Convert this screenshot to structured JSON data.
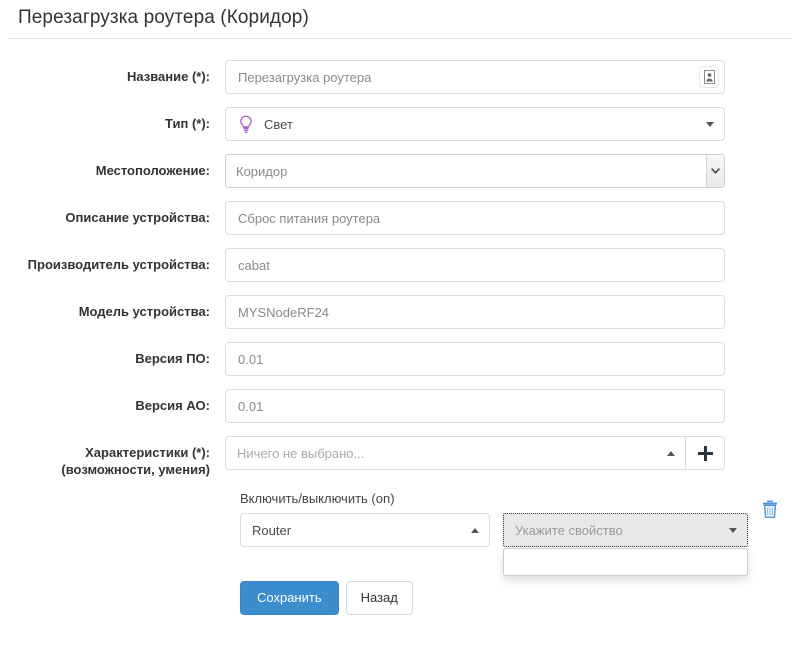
{
  "header": {
    "title": "Перезагрузка роутера (Коридор)"
  },
  "form": {
    "rows": [
      {
        "label": "Название (*):",
        "value": "Перезагрузка роутера",
        "icon": "credential-card-icon"
      },
      {
        "label": "Тип (*):",
        "value": "Свет",
        "icon": "lightbulb-icon"
      },
      {
        "label": "Местоположение:",
        "value": "Коридор",
        "icon": "chevron-down-icon"
      },
      {
        "label": "Описание устройства:",
        "value": "Сброс питания роутера",
        "icon": ""
      },
      {
        "label": "Производитель устройства:",
        "value": "cabat",
        "icon": ""
      },
      {
        "label": "Модель устройства:",
        "value": "MYSNodeRF24",
        "icon": ""
      },
      {
        "label": "Версия ПО:",
        "value": "0.01",
        "icon": ""
      },
      {
        "label": "Версия АО:",
        "value": "0.01",
        "icon": ""
      }
    ],
    "capabilities": {
      "label_main": "Характеристики (*):",
      "label_sub": "(возможности, умения)",
      "placeholder": "Ничего не выбрано...",
      "add_button": "+",
      "add_button_name": "plus-icon"
    },
    "capability_item": {
      "title": "Включить/выключить (on)",
      "device_value": "Router",
      "property_placeholder": "Укажите свойство",
      "delete_icon": "trash-icon"
    }
  },
  "actions": {
    "save_label": "Сохранить",
    "back_label": "Назад"
  },
  "colors": {
    "primary": "#3c8dcd",
    "bulb": "#a855b8",
    "trash": "#4a93d9",
    "text": "#333333"
  }
}
